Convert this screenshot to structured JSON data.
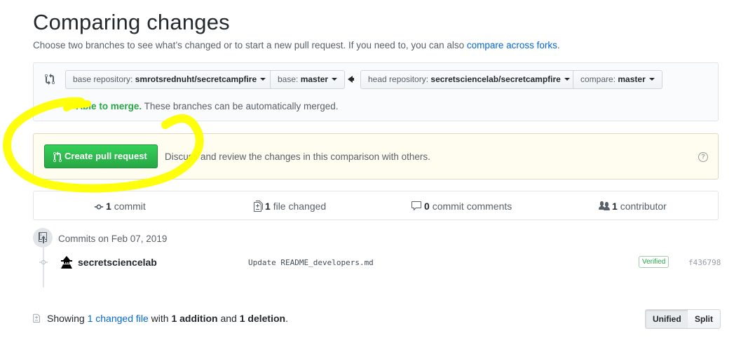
{
  "header": {
    "title": "Comparing changes",
    "subtitle_prefix": "Choose two branches to see what’s changed or to start a new pull request. If you need to, you can also ",
    "subtitle_link": "compare across forks",
    "subtitle_suffix": "."
  },
  "range": {
    "base_repo_label": "base repository:",
    "base_repo_value": "smrotsrednuht/secretcampfire",
    "base_label": "base:",
    "base_value": "master",
    "head_repo_label": "head repository:",
    "head_repo_value": "secretsciencelab/secretcampfire",
    "compare_label": "compare:",
    "compare_value": "master",
    "merge_status": "Able to merge.",
    "merge_text": " These branches can be automatically merged."
  },
  "compose": {
    "button_label": "Create pull request",
    "description": "Discuss and review the changes in this comparison with others.",
    "help_glyph": "?"
  },
  "summary": {
    "commits_count": "1",
    "commits_label": "commit",
    "files_count": "1",
    "files_label": "file changed",
    "comments_count": "0",
    "comments_label": "commit comments",
    "contributors_count": "1",
    "contributors_label": "contributor"
  },
  "commits": {
    "date_label": "Commits on Feb 07, 2019",
    "items": [
      {
        "author": "secretsciencelab",
        "message": "Update README_developers.md",
        "badge": "Verified",
        "sha": "f436798"
      }
    ]
  },
  "diff": {
    "showing_prefix": "Showing ",
    "changed_link": "1 changed file",
    "with_text": " with ",
    "additions": "1 addition",
    "and_text": " and ",
    "deletions": "1 deletion",
    "end": ".",
    "unified_label": "Unified",
    "split_label": "Split"
  },
  "icons": {
    "range": "git-compare-icon",
    "create": "git-pull-request-icon",
    "commits": "git-commit-icon",
    "files": "file-diff-icon",
    "comments": "comment-icon",
    "contributors": "people-icon",
    "help": "question-icon",
    "calendar": "repo-push-icon",
    "file": "file-icon"
  },
  "colors": {
    "accent_link": "#0366d6",
    "success": "#28a745",
    "annotation_highlight": "#ffff00"
  }
}
